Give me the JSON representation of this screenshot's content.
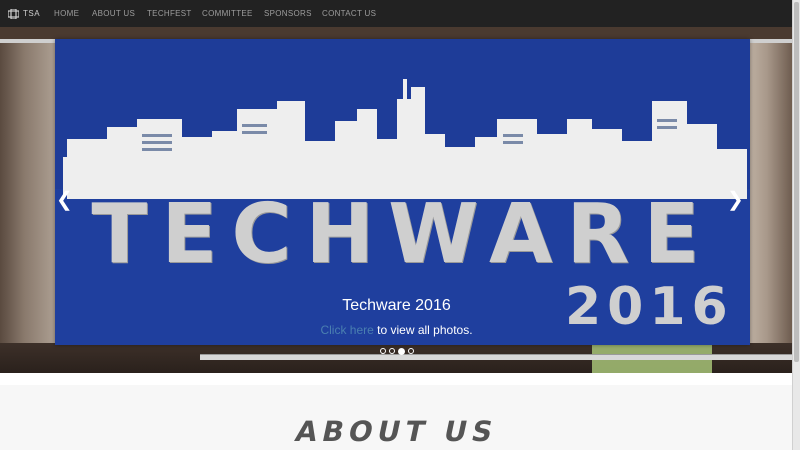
{
  "nav": {
    "brand": "TSA",
    "links": [
      "HOME",
      "ABOUT US",
      "TECHFEST",
      "COMMITTEE",
      "SPONSORS",
      "CONTACT US"
    ]
  },
  "hero": {
    "banner_word": "TECHWARE",
    "banner_year": "2016",
    "caption_title": "Techware 2016",
    "caption_link": "Click here",
    "caption_rest": " to view all photos.",
    "slide_count": 4,
    "active_slide": 3
  },
  "about": {
    "title": "ABOUT US"
  },
  "colors": {
    "navbar_bg": "#222222",
    "nav_text": "#9d9d9d",
    "banner_blue": "#1f3f9e",
    "caption_link": "#4a7fb0",
    "heading_gray": "#555555"
  },
  "icons": {
    "brand_logo": "tsa-logo-icon",
    "prev": "chevron-left-icon",
    "next": "chevron-right-icon"
  }
}
